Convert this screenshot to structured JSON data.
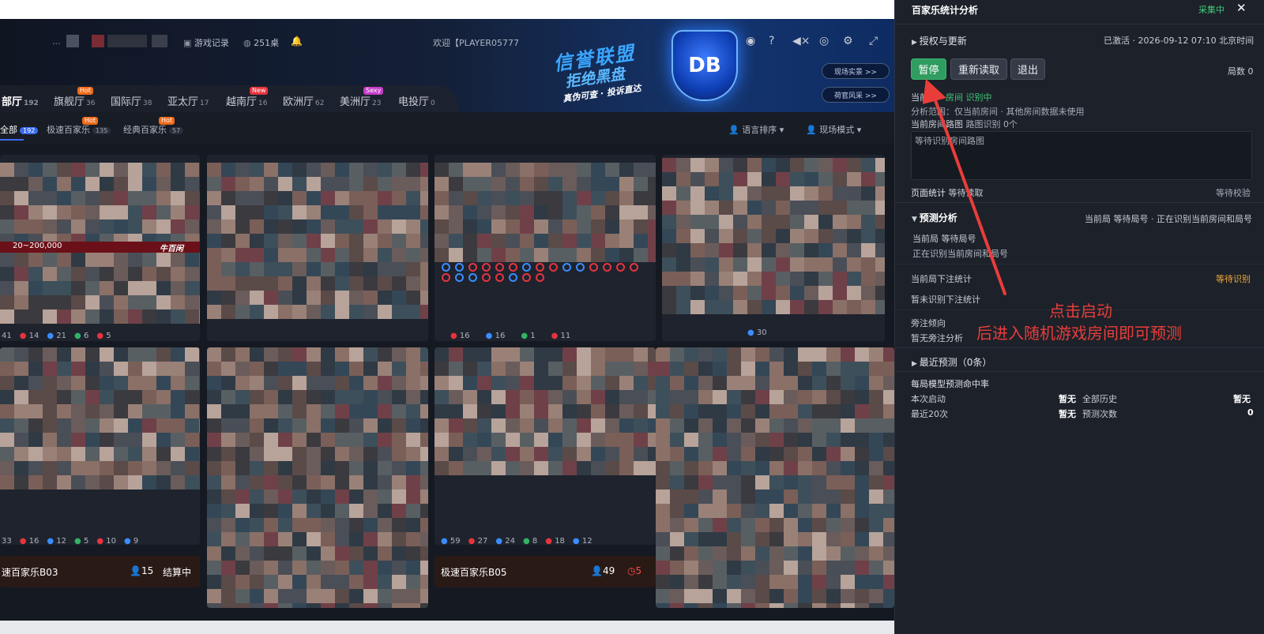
{
  "header": {
    "user_suffix": "...",
    "game_record": "游戏记录",
    "tables": "251桌",
    "welcome": "欢迎【PLAYER05777",
    "banner_line1": "信誉联盟",
    "banner_line2": "拒绝黑盘",
    "banner_line3": "真伪可查 · 投诉直达",
    "logo": "DB",
    "btn_live": "现场实景 >>",
    "btn_dealer": "荷官风采 >>"
  },
  "halls": [
    {
      "label": "部厅",
      "count": "192"
    },
    {
      "label": "旗舰厅",
      "count": "36",
      "badge": "Hot"
    },
    {
      "label": "国际厅",
      "count": "38"
    },
    {
      "label": "亚太厅",
      "count": "17"
    },
    {
      "label": "越南厅",
      "count": "16",
      "badge": "New"
    },
    {
      "label": "欧洲厅",
      "count": "62"
    },
    {
      "label": "美洲厅",
      "count": "23",
      "badge": "Sexy"
    },
    {
      "label": "电投厅",
      "count": "0"
    }
  ],
  "subnav": {
    "all": "全部",
    "all_count": "192",
    "fast": "极速百家乐",
    "fast_count": "135",
    "fast_badge": "Hot",
    "classic": "经典百家乐",
    "classic_count": "57",
    "classic_badge": "Hot",
    "lang_sort": "语言排序",
    "live_mode": "现场模式"
  },
  "cards": {
    "c1_range": "20~200,000",
    "c1_tag": "牛百闲",
    "c1_stats": [
      "41",
      "14",
      "21",
      "6",
      "5"
    ],
    "c3_stats": [
      "16",
      "16",
      "1",
      "11"
    ],
    "c4_stats": [
      "30"
    ],
    "c5_stats": [
      "33",
      "16",
      "12",
      "5",
      "10",
      "9"
    ],
    "c7_stats": [
      "59",
      "27",
      "24",
      "8",
      "18",
      "12"
    ],
    "caption1": "速百家乐B03",
    "caption1_people": "15",
    "caption1_status": "结算中",
    "caption2": "极速百家乐B05",
    "caption2_people": "49",
    "caption2_timer": "5"
  },
  "panel": {
    "title": "百家乐统计分析",
    "status": "采集中",
    "close": "✕",
    "auth": "授权与更新",
    "activated": "已激活 · 2026-09-12 07:10 北京时间",
    "btn_pause": "暂停",
    "btn_reload": "重新读取",
    "btn_exit": "退出",
    "rounds": "局数 0",
    "current_prefix": "当前",
    "current_room": "房间",
    "current_state": "识别中",
    "scope": "分析范围：仅当前房间 · 其他房间数据未使用",
    "roadmap": "当前房间路图",
    "roadmap_count": "路图识别 0个",
    "roadmap_wait": "等待识别房间路图",
    "page_stats": "页面统计",
    "page_stats_wait": "等待读取",
    "verify": "等待校验",
    "predict_title": "预测分析",
    "predict_status": "当前局 等待局号 · 正在识别当前房间和局号",
    "cur_round": "当前局",
    "cur_round_wait": "等待局号",
    "recognizing": "正在识别当前房间和局号",
    "bet_stats": "当前局下注统计",
    "bet_wait": "等待识别",
    "bet_none": "暂未识别下注统计",
    "side_trend": "旁注倾向",
    "side_none": "暂无旁注分析",
    "recent": "最近预测（0条）",
    "hit_rate": "每局模型预测命中率",
    "this_start": "本次启动",
    "this_start_val": "暂无",
    "all_history": "全部历史",
    "all_history_val": "暂无",
    "last20": "最近20次",
    "last20_val": "暂无",
    "predict_count": "预测次数",
    "predict_count_val": "0"
  },
  "annotation": {
    "line1": "点击启动",
    "line2": "后进入随机游戏房间即可预测"
  },
  "colors": {
    "accent_red": "#e93d3a",
    "green_btn": "#2f9d5f",
    "status_green": "#3fc97a",
    "wait_orange": "#f0a93a"
  }
}
